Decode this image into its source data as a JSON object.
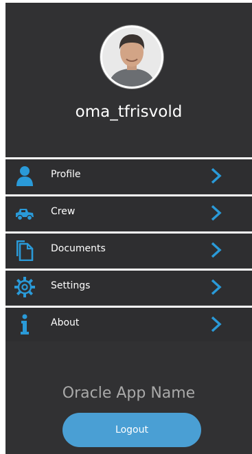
{
  "header": {
    "username": "oma_tfrisvold"
  },
  "menu": [
    {
      "label": "Profile",
      "icon": "person-icon"
    },
    {
      "label": "Crew",
      "icon": "truck-icon"
    },
    {
      "label": "Documents",
      "icon": "documents-icon"
    },
    {
      "label": "Settings",
      "icon": "gear-icon"
    },
    {
      "label": "About",
      "icon": "info-icon"
    }
  ],
  "footer": {
    "app_name": "Oracle App Name",
    "logout_label": "Logout"
  },
  "colors": {
    "panel_bg": "#313133",
    "accent": "#2a9ad8",
    "logout_bg": "#4a9fd4"
  }
}
